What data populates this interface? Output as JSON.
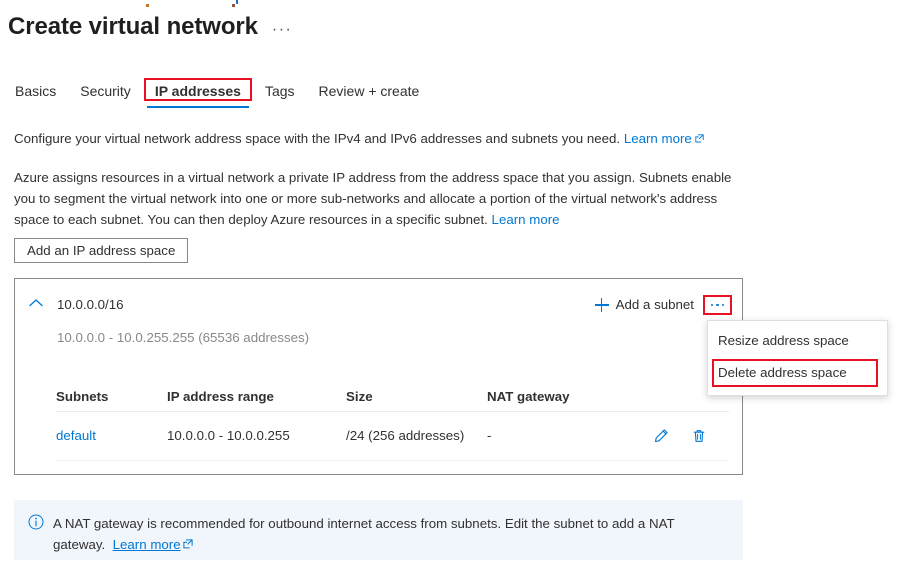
{
  "header": {
    "title": "Create virtual network",
    "ellipsis": "···"
  },
  "tabs": [
    {
      "label": "Basics",
      "selected": false
    },
    {
      "label": "Security",
      "selected": false
    },
    {
      "label": "IP addresses",
      "selected": true,
      "highlighted": true
    },
    {
      "label": "Tags",
      "selected": false
    },
    {
      "label": "Review + create",
      "selected": false
    }
  ],
  "intro": {
    "paragraph1": "Configure your virtual network address space with the IPv4 and IPv6 addresses and subnets you need.",
    "paragraph1_link": "Learn more",
    "paragraph2": "Azure assigns resources in a virtual network a private IP address from the address space that you assign. Subnets enable you to segment the virtual network into one or more sub-networks and allocate a portion of the virtual network's address space to each subnet. You can then deploy Azure resources in a specific subnet.",
    "paragraph2_link": "Learn more"
  },
  "add_address_space_button": "Add an IP address space",
  "address_space": {
    "cidr": "10.0.0.0/16",
    "range_summary": "10.0.0.0 - 10.0.255.255 (65536 addresses)",
    "add_subnet_label": "Add a subnet",
    "more_actions_label": "···",
    "columns": [
      "Subnets",
      "IP address range",
      "Size",
      "NAT gateway"
    ],
    "rows": [
      {
        "subnet": "default",
        "ip_address_range": "10.0.0.0 - 10.0.0.255",
        "size": "/24 (256 addresses)",
        "nat_gateway": "-"
      }
    ]
  },
  "context_menu": {
    "items": [
      {
        "label": "Resize address space",
        "highlighted": false
      },
      {
        "label": "Delete address space",
        "highlighted": true
      }
    ]
  },
  "info_banner": {
    "text": "A NAT gateway is recommended for outbound internet access from subnets. Edit the subnet to add a NAT gateway.",
    "link": "Learn more"
  },
  "colors": {
    "accent": "#0078d4",
    "highlight": "#e81123",
    "banner_bg": "#f0f6fc",
    "muted_text": "#8a8886",
    "border": "#8a8886"
  }
}
